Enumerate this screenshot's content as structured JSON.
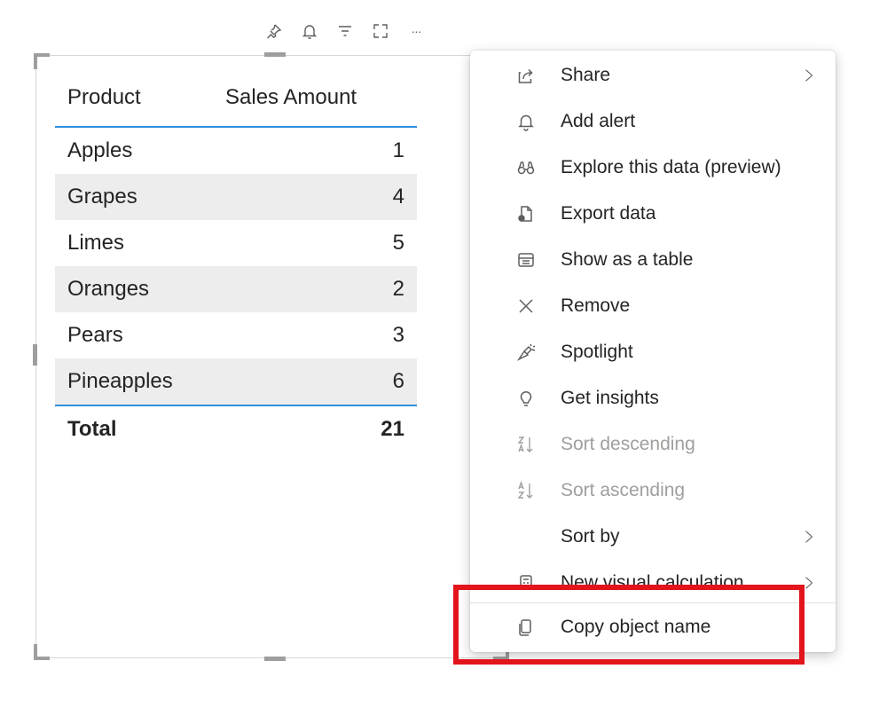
{
  "visual_header": {
    "icons": [
      "pin-icon",
      "alert-bell-icon",
      "filter-icon",
      "focus-mode-icon",
      "more-options-icon"
    ],
    "more_label": "···"
  },
  "table": {
    "columns": [
      "Product",
      "Sales Amount"
    ],
    "rows": [
      {
        "product": "Apples",
        "amount": "1"
      },
      {
        "product": "Grapes",
        "amount": "4"
      },
      {
        "product": "Limes",
        "amount": "5"
      },
      {
        "product": "Oranges",
        "amount": "2"
      },
      {
        "product": "Pears",
        "amount": "3"
      },
      {
        "product": "Pineapples",
        "amount": "6"
      }
    ],
    "total_label": "Total",
    "total_value": "21",
    "accent_color": "#2f8fdf",
    "alt_row_color": "#ededed"
  },
  "context_menu": {
    "items": [
      {
        "label": "Share",
        "icon": "share-icon",
        "submenu": true,
        "disabled": false
      },
      {
        "label": "Add alert",
        "icon": "alert-bell-icon",
        "submenu": false,
        "disabled": false
      },
      {
        "label": "Explore this data (preview)",
        "icon": "explore-binoculars-icon",
        "submenu": false,
        "disabled": false
      },
      {
        "label": "Export data",
        "icon": "export-data-icon",
        "submenu": false,
        "disabled": false
      },
      {
        "label": "Show as a table",
        "icon": "table-view-icon",
        "submenu": false,
        "disabled": false
      },
      {
        "label": "Remove",
        "icon": "close-icon",
        "submenu": false,
        "disabled": false
      },
      {
        "label": "Spotlight",
        "icon": "spotlight-icon",
        "submenu": false,
        "disabled": false
      },
      {
        "label": "Get insights",
        "icon": "lightbulb-icon",
        "submenu": false,
        "disabled": false
      },
      {
        "label": "Sort descending",
        "icon": "sort-descending-icon",
        "submenu": false,
        "disabled": true
      },
      {
        "label": "Sort ascending",
        "icon": "sort-ascending-icon",
        "submenu": false,
        "disabled": true
      },
      {
        "label": "Sort by",
        "icon": "",
        "submenu": true,
        "disabled": false
      },
      {
        "label": "New visual calculation",
        "icon": "visual-calculation-icon",
        "submenu": true,
        "disabled": false
      },
      {
        "label": "Copy object name",
        "icon": "copy-icon",
        "submenu": false,
        "disabled": false
      }
    ]
  },
  "highlight_color": "#e3141c"
}
